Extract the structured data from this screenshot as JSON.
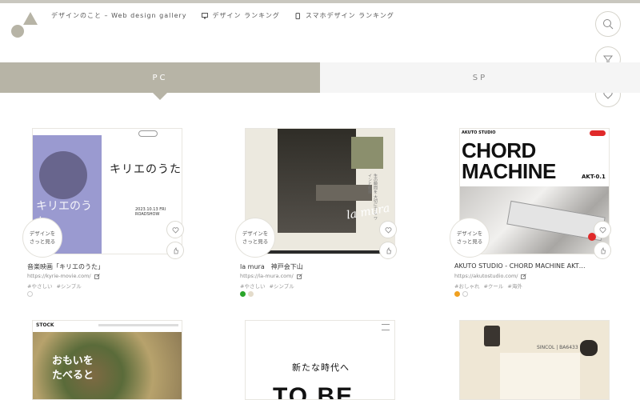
{
  "site": {
    "nav": [
      {
        "label": "デザインのこと – Web design gallery",
        "icon": ""
      },
      {
        "label": "デザイン ランキング",
        "icon": "monitor-icon"
      },
      {
        "label": "スマホデザイン ランキング",
        "icon": "phone-icon"
      }
    ]
  },
  "tabs": [
    {
      "label": "PC",
      "active": true
    },
    {
      "label": "SP",
      "active": false
    }
  ],
  "card_badge": "デザインを\nさっと見る",
  "cards": [
    {
      "title": "音楽映画「キリエのうた」",
      "url": "https://kyrie-movie.com/",
      "tags": [
        "#やさしい",
        "#シンプル"
      ],
      "colors": [
        "#ffffff"
      ],
      "thumb": {
        "title": "キリエのうた",
        "date": "2023.10.13 FRI ROADSHOW",
        "cinema": "キリエのうた"
      }
    },
    {
      "title": "la mura　神戸会下山",
      "url": "https://la-mura.com/",
      "tags": [
        "#やさしい",
        "#シンプル"
      ],
      "colors": [
        "#2aa52a",
        "#e4dccb"
      ],
      "thumb": {
        "logo": "la mura",
        "text": "生の瞬間を 大切にする ワインと料理"
      }
    },
    {
      "title": "AKUTO STUDIO - CHORD MACHINE AKT…",
      "url": "https://akutostudio.com/",
      "tags": [
        "#おしゃれ",
        "#クール",
        "#海外"
      ],
      "colors": [
        "#f0a020",
        "#ffffff"
      ],
      "thumb": {
        "head": "AKUTO STUDIO",
        "title_line1": "CHORD",
        "title_line2": "MACHINE",
        "sub": "AKT-0.1"
      }
    },
    {
      "thumb": {
        "head": "STOCK",
        "text_line1": "おもいを",
        "text_line2": "たべると"
      }
    },
    {
      "thumb": {
        "text": "新たな時代へ",
        "big": "TO BE"
      }
    },
    {
      "thumb": {
        "label": "SINCOL | BA6433"
      }
    }
  ],
  "icons": {
    "search": "search-icon",
    "filter": "filter-icon",
    "favorite": "heart-icon"
  }
}
